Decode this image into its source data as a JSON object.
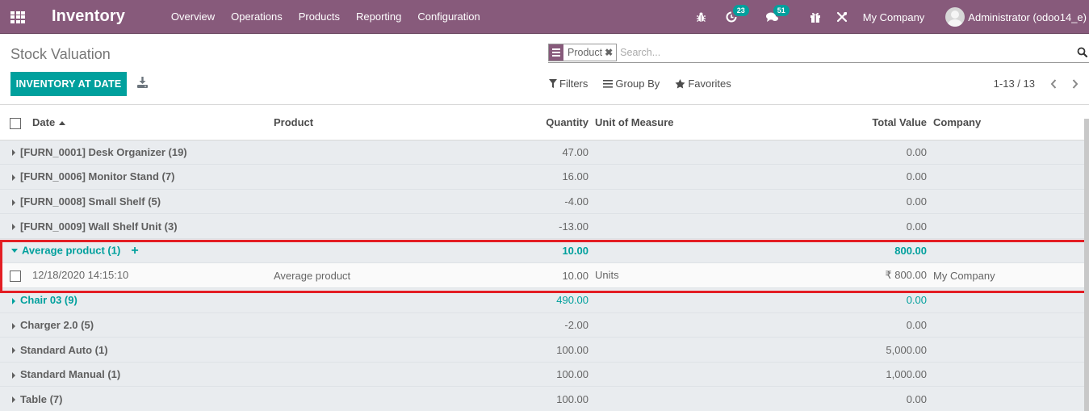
{
  "navbar": {
    "app_title": "Inventory",
    "menu": [
      "Overview",
      "Operations",
      "Products",
      "Reporting",
      "Configuration"
    ],
    "activity_count": "23",
    "messages_count": "51",
    "company": "My Company",
    "user": "Administrator (odoo14_e)"
  },
  "control_panel": {
    "title": "Stock Valuation",
    "inventory_at_date_label": "INVENTORY AT DATE",
    "search": {
      "facet_label": "Product",
      "facet_remove": "✖",
      "placeholder": "Search...",
      "value": ""
    },
    "filters_label": "Filters",
    "group_by_label": "Group By",
    "favorites_label": "Favorites",
    "pager": "1-13 / 13"
  },
  "table": {
    "columns": {
      "date": "Date",
      "product": "Product",
      "quantity": "Quantity",
      "uom": "Unit of Measure",
      "total_value": "Total Value",
      "company": "Company"
    },
    "groups": [
      {
        "label": "[FURN_0001] Desk Organizer (19)",
        "quantity": "47.00",
        "total_value": "0.00"
      },
      {
        "label": "[FURN_0006] Monitor Stand (7)",
        "quantity": "16.00",
        "total_value": "0.00"
      },
      {
        "label": "[FURN_0008] Small Shelf (5)",
        "quantity": "-4.00",
        "total_value": "0.00"
      },
      {
        "label": "[FURN_0009] Wall Shelf Unit (3)",
        "quantity": "-13.00",
        "total_value": "0.00"
      },
      {
        "label": "Average product (1)",
        "quantity": "10.00",
        "total_value": "800.00",
        "expanded": true,
        "records": [
          {
            "date": "12/18/2020 14:15:10",
            "product": "Average product",
            "quantity": "10.00",
            "uom": "Units",
            "total_value": "₹ 800.00",
            "company": "My Company"
          }
        ]
      },
      {
        "label": "Chair 03 (9)",
        "quantity": "490.00",
        "total_value": "0.00"
      },
      {
        "label": "Charger 2.0 (5)",
        "quantity": "-2.00",
        "total_value": "0.00"
      },
      {
        "label": "Standard Auto (1)",
        "quantity": "100.00",
        "total_value": "5,000.00"
      },
      {
        "label": "Standard Manual (1)",
        "quantity": "100.00",
        "total_value": "1,000.00"
      },
      {
        "label": "Table (7)",
        "quantity": "100.00",
        "total_value": "0.00"
      }
    ]
  },
  "colors": {
    "brand": "#875a7b",
    "accent": "#00a09d",
    "highlight": "#e31e24"
  }
}
